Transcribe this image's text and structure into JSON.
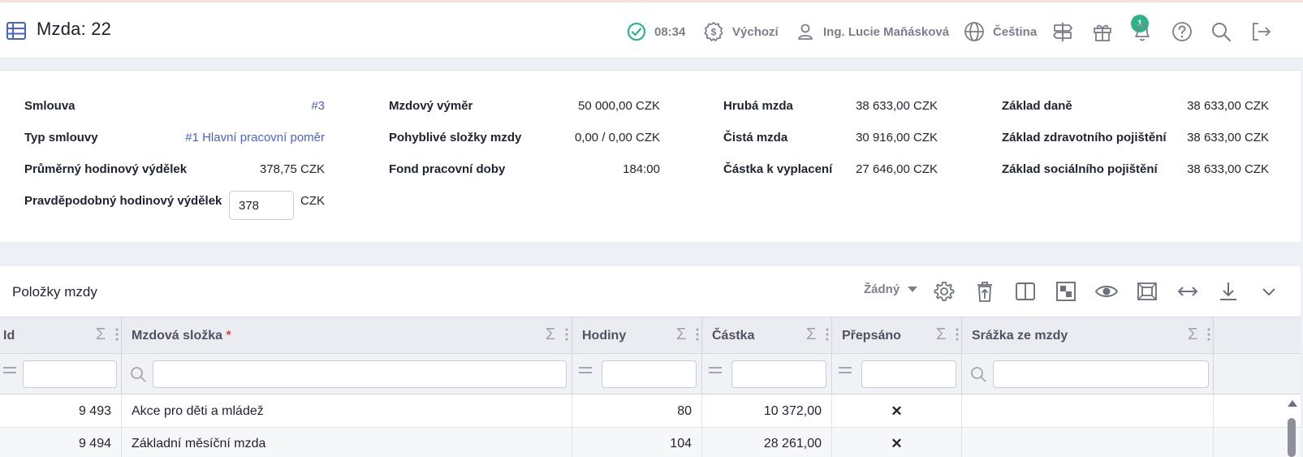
{
  "header": {
    "title": "Mzda: 22",
    "time": "08:34",
    "currency_profile": "Výchozí",
    "user_name": "Ing. Lucie Maňásková",
    "language": "Čeština",
    "gift_badge_count": "1",
    "icons": [
      "table-icon",
      "check-circle-icon",
      "dollar-circle-icon",
      "user-icon",
      "globe-icon",
      "signpost-icon",
      "gift-icon",
      "bell-icon",
      "help-icon",
      "search-icon",
      "logout-icon"
    ],
    "colors": {
      "accent": "#4a63c9",
      "success": "#2db38a"
    }
  },
  "summary": {
    "smlouva_label": "Smlouva",
    "smlouva_value": "#3",
    "typ_label": "Typ smlouvy",
    "typ_value": "#1 Hlavní pracovní poměr",
    "prumerny_label": "Průměrný hodinový výdělek",
    "prumerny_value": "378,75 CZK",
    "pravdepodobny_label": "Pravděpodobný hodinový výdělek",
    "pravdepodobny_value": "378",
    "pravdepodobny_unit": "CZK",
    "vymer_label": "Mzdový výměr",
    "vymer_value": "50 000,00 CZK",
    "pohyblive_label": "Pohyblivé složky mzdy",
    "pohyblive_value": "0,00 / 0,00 CZK",
    "fond_label": "Fond pracovní doby",
    "fond_value": "184:00",
    "hruba_label": "Hrubá mzda",
    "hruba_value": "38 633,00 CZK",
    "cista_label": "Čistá mzda",
    "cista_value": "30 916,00 CZK",
    "castka_label": "Částka k vyplacení",
    "castka_value": "27 646,00 CZK",
    "zaklad_dane_label": "Základ daně",
    "zaklad_dane_value": "38 633,00 CZK",
    "zaklad_zdrav_label": "Základ zdravotního pojištění",
    "zaklad_zdrav_value": "38 633,00 CZK",
    "zaklad_soc_label": "Základ sociálního pojištění",
    "zaklad_soc_value": "38 633,00 CZK"
  },
  "grid": {
    "title": "Položky mzdy",
    "view_select": "Žádný",
    "sigma": "Σ",
    "columns": {
      "id": "Id",
      "slozka": "Mzdová složka",
      "slozka_required": "*",
      "hodiny": "Hodiny",
      "castka": "Částka",
      "prepsano": "Přepsáno",
      "srazka": "Srážka ze mzdy"
    },
    "rows": [
      {
        "id": "9 493",
        "slozka": "Akce pro děti a mládež",
        "hodiny": "80",
        "castka": "10 372,00",
        "prepsano": "✕",
        "srazka": ""
      },
      {
        "id": "9 494",
        "slozka": "Základní měsíční mzda",
        "hodiny": "104",
        "castka": "28 261,00",
        "prepsano": "✕",
        "srazka": ""
      }
    ]
  }
}
